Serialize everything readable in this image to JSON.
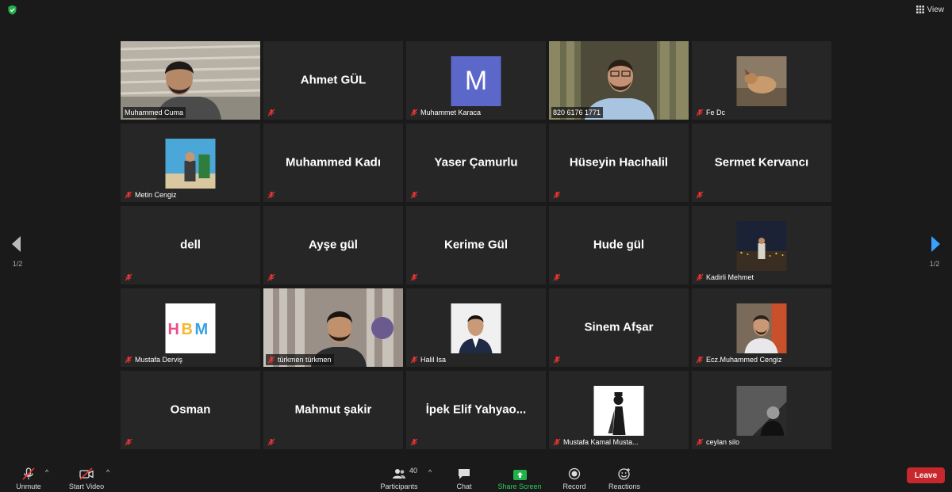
{
  "top": {
    "view_label": "View"
  },
  "pager": {
    "left": "1/2",
    "right": "1/2"
  },
  "tiles": [
    {
      "display_name": "",
      "label": "Muhammed Cuma"
    },
    {
      "display_name": "Ahmet GÜL",
      "label": ""
    },
    {
      "display_name": "",
      "label": "Muhammet Karaca",
      "avatar_letter": "M"
    },
    {
      "display_name": "",
      "label": "820 6176 1771"
    },
    {
      "display_name": "",
      "label": "Fe Dc"
    },
    {
      "display_name": "",
      "label": "Metin Cengiz"
    },
    {
      "display_name": "Muhammed Kadı",
      "label": ""
    },
    {
      "display_name": "Yaser Çamurlu",
      "label": ""
    },
    {
      "display_name": "Hüseyin Hacıhalil",
      "label": ""
    },
    {
      "display_name": "Sermet Kervancı",
      "label": ""
    },
    {
      "display_name": "dell",
      "label": ""
    },
    {
      "display_name": "Ayşe gül",
      "label": ""
    },
    {
      "display_name": "Kerime Gül",
      "label": ""
    },
    {
      "display_name": "Hude gül",
      "label": ""
    },
    {
      "display_name": "",
      "label": "Kadirli Mehmet"
    },
    {
      "display_name": "",
      "label": "Mustafa Derviş",
      "logo_text": "HBM"
    },
    {
      "display_name": "",
      "label": "türkmen türkmen"
    },
    {
      "display_name": "",
      "label": "Halil Isa"
    },
    {
      "display_name": "Sinem Afşar",
      "label": ""
    },
    {
      "display_name": "",
      "label": "Ecz.Muhammed Cengiz"
    },
    {
      "display_name": "Osman",
      "label": ""
    },
    {
      "display_name": "Mahmut şakir",
      "label": ""
    },
    {
      "display_name": "İpek Elif Yahyao...",
      "label": ""
    },
    {
      "display_name": "",
      "label": "Mustafa Kamal Musta..."
    },
    {
      "display_name": "",
      "label": "ceylan silo"
    }
  ],
  "toolbar": {
    "unmute": "Unmute",
    "start_video": "Start Video",
    "participants": "Participants",
    "participants_count": "40",
    "chat": "Chat",
    "share_screen": "Share Screen",
    "record": "Record",
    "reactions": "Reactions",
    "leave": "Leave"
  },
  "colors": {
    "active_speaker": "#c5e85e",
    "share": "#22b24c",
    "leave": "#c8282b",
    "avatar_m": "#5b67c9"
  }
}
